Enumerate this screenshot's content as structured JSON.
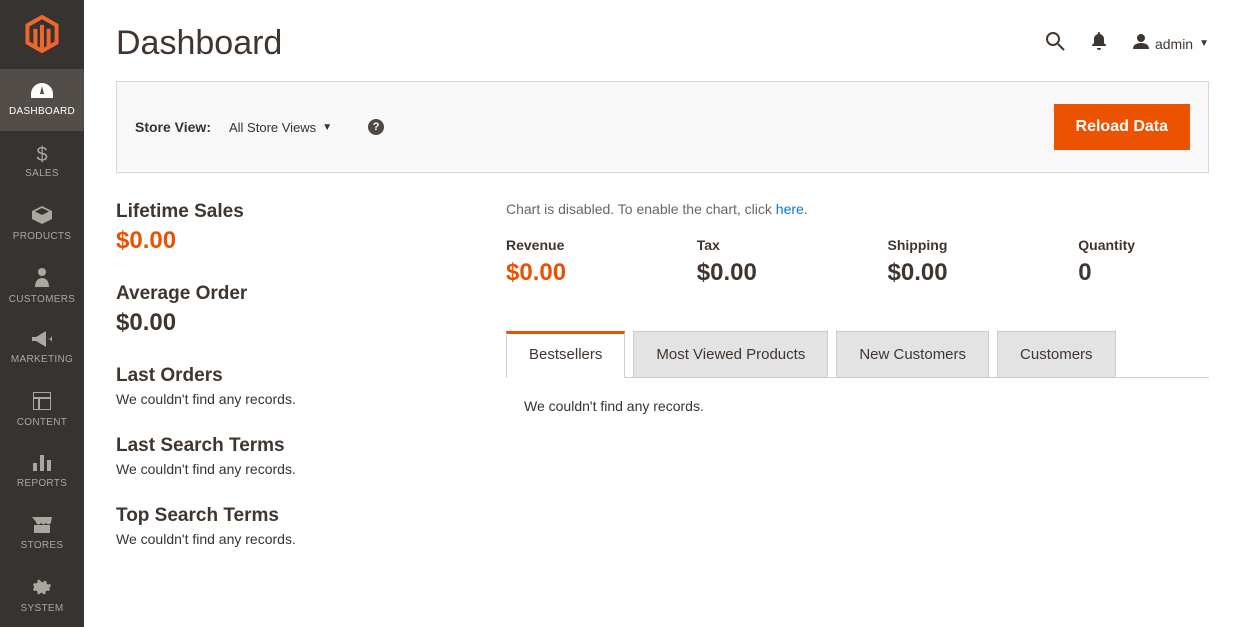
{
  "sidebar": {
    "items": [
      {
        "label": "DASHBOARD"
      },
      {
        "label": "SALES"
      },
      {
        "label": "PRODUCTS"
      },
      {
        "label": "CUSTOMERS"
      },
      {
        "label": "MARKETING"
      },
      {
        "label": "CONTENT"
      },
      {
        "label": "REPORTS"
      },
      {
        "label": "STORES"
      },
      {
        "label": "SYSTEM"
      }
    ]
  },
  "header": {
    "title": "Dashboard",
    "user": "admin"
  },
  "viewbar": {
    "label": "Store View:",
    "selected": "All Store Views",
    "help": "?",
    "reload": "Reload Data"
  },
  "left_stats": {
    "lifetime_sales_label": "Lifetime Sales",
    "lifetime_sales_value": "$0.00",
    "average_order_label": "Average Order",
    "average_order_value": "$0.00",
    "last_orders_label": "Last Orders",
    "last_orders_note": "We couldn't find any records.",
    "last_search_label": "Last Search Terms",
    "last_search_note": "We couldn't find any records.",
    "top_search_label": "Top Search Terms",
    "top_search_note": "We couldn't find any records."
  },
  "chart": {
    "disabled_prefix": "Chart is disabled. To enable the chart, click ",
    "link": "here",
    "suffix": "."
  },
  "totals": {
    "revenue_label": "Revenue",
    "revenue_value": "$0.00",
    "tax_label": "Tax",
    "tax_value": "$0.00",
    "shipping_label": "Shipping",
    "shipping_value": "$0.00",
    "quantity_label": "Quantity",
    "quantity_value": "0"
  },
  "tabs": {
    "items": [
      {
        "label": "Bestsellers"
      },
      {
        "label": "Most Viewed Products"
      },
      {
        "label": "New Customers"
      },
      {
        "label": "Customers"
      }
    ],
    "content": "We couldn't find any records."
  }
}
